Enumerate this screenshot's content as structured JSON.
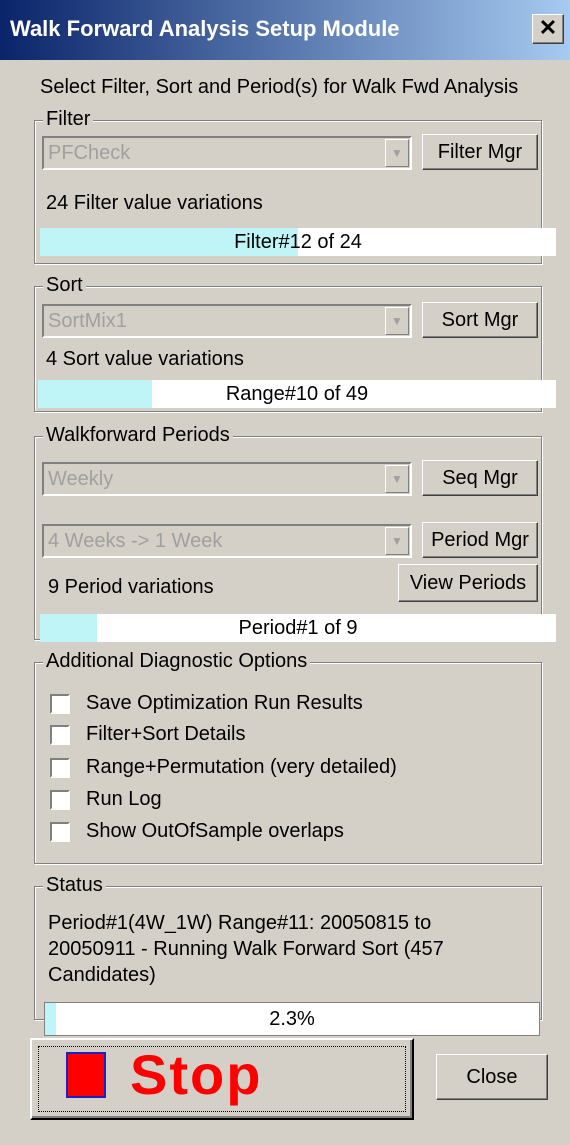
{
  "window": {
    "title": "Walk Forward Analysis Setup Module",
    "close_glyph": "✕"
  },
  "subtitle": "Select Filter, Sort and Period(s) for Walk Fwd Analysis",
  "filter": {
    "legend": "Filter",
    "selected": "PFCheck",
    "manager_button": "Filter Mgr",
    "variations_text": "24 Filter value variations",
    "progress": {
      "text": "Filter#12 of 24",
      "fraction": 0.5
    }
  },
  "sort": {
    "legend": "Sort",
    "selected": "SortMix1",
    "manager_button": "Sort Mgr",
    "variations_text": "4 Sort value variations",
    "progress": {
      "text": "Range#10 of 49",
      "fraction": 0.2
    }
  },
  "periods": {
    "legend": "Walkforward Periods",
    "sequence_selected": "Weekly",
    "seq_manager_button": "Seq Mgr",
    "period_selected": "4 Weeks -> 1 Week",
    "period_manager_button": "Period Mgr",
    "view_periods_button": "View Periods",
    "variations_text": "9 Period variations",
    "progress": {
      "text": "Period#1 of 9",
      "fraction": 0.11
    }
  },
  "diagnostics": {
    "legend": "Additional Diagnostic Options",
    "options": [
      {
        "label": "Save Optimization Run Results",
        "checked": false
      },
      {
        "label": "Filter+Sort Details",
        "checked": false
      },
      {
        "label": "Range+Permutation (very detailed)",
        "checked": false
      },
      {
        "label": "Run Log",
        "checked": false
      },
      {
        "label": "Show OutOfSample overlaps",
        "checked": false
      }
    ]
  },
  "status": {
    "legend": "Status",
    "message_line1": "Period#1(4W_1W) Range#11: 20050815 to",
    "message_line2": "20050911 - Running Walk Forward Sort (457",
    "message_line3": "Candidates)",
    "progress": {
      "text": "2.3%",
      "fraction": 0.023
    }
  },
  "buttons": {
    "stop": "Stop",
    "close": "Close"
  },
  "colors": {
    "progress_fill": "#bff5f7",
    "stop_red": "#ff0000",
    "titlebar_start": "#0a246a"
  }
}
